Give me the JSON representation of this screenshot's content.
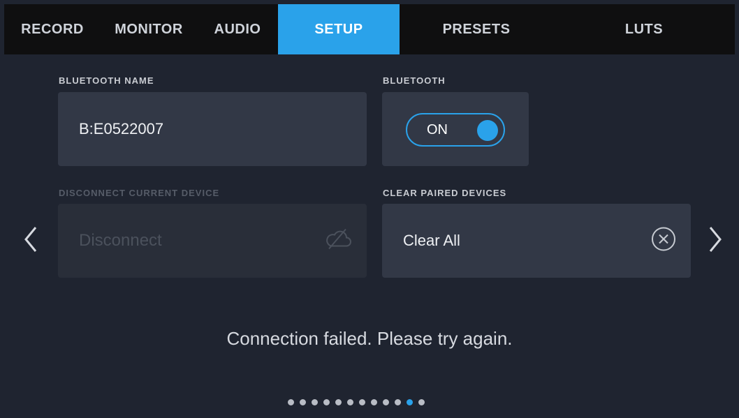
{
  "tabs": [
    {
      "label": "RECORD"
    },
    {
      "label": "MONITOR"
    },
    {
      "label": "AUDIO"
    },
    {
      "label": "SETUP",
      "active": true
    },
    {
      "label": "PRESETS"
    },
    {
      "label": "LUTS"
    }
  ],
  "bluetooth_name": {
    "label": "BLUETOOTH NAME",
    "value": "B:E0522007"
  },
  "bluetooth": {
    "label": "BLUETOOTH",
    "state": "ON"
  },
  "disconnect": {
    "label": "DISCONNECT CURRENT DEVICE",
    "button": "Disconnect",
    "enabled": false,
    "icon": "cloud-off-icon"
  },
  "clear_paired": {
    "label": "CLEAR PAIRED DEVICES",
    "button": "Clear All",
    "icon": "close-circle-icon"
  },
  "status_message": "Connection failed. Please try again.",
  "pagination": {
    "total": 12,
    "current": 11
  },
  "colors": {
    "accent": "#2aa2ea",
    "background": "#1f2430",
    "card": "#323846",
    "tabbar": "#0f0f10"
  }
}
